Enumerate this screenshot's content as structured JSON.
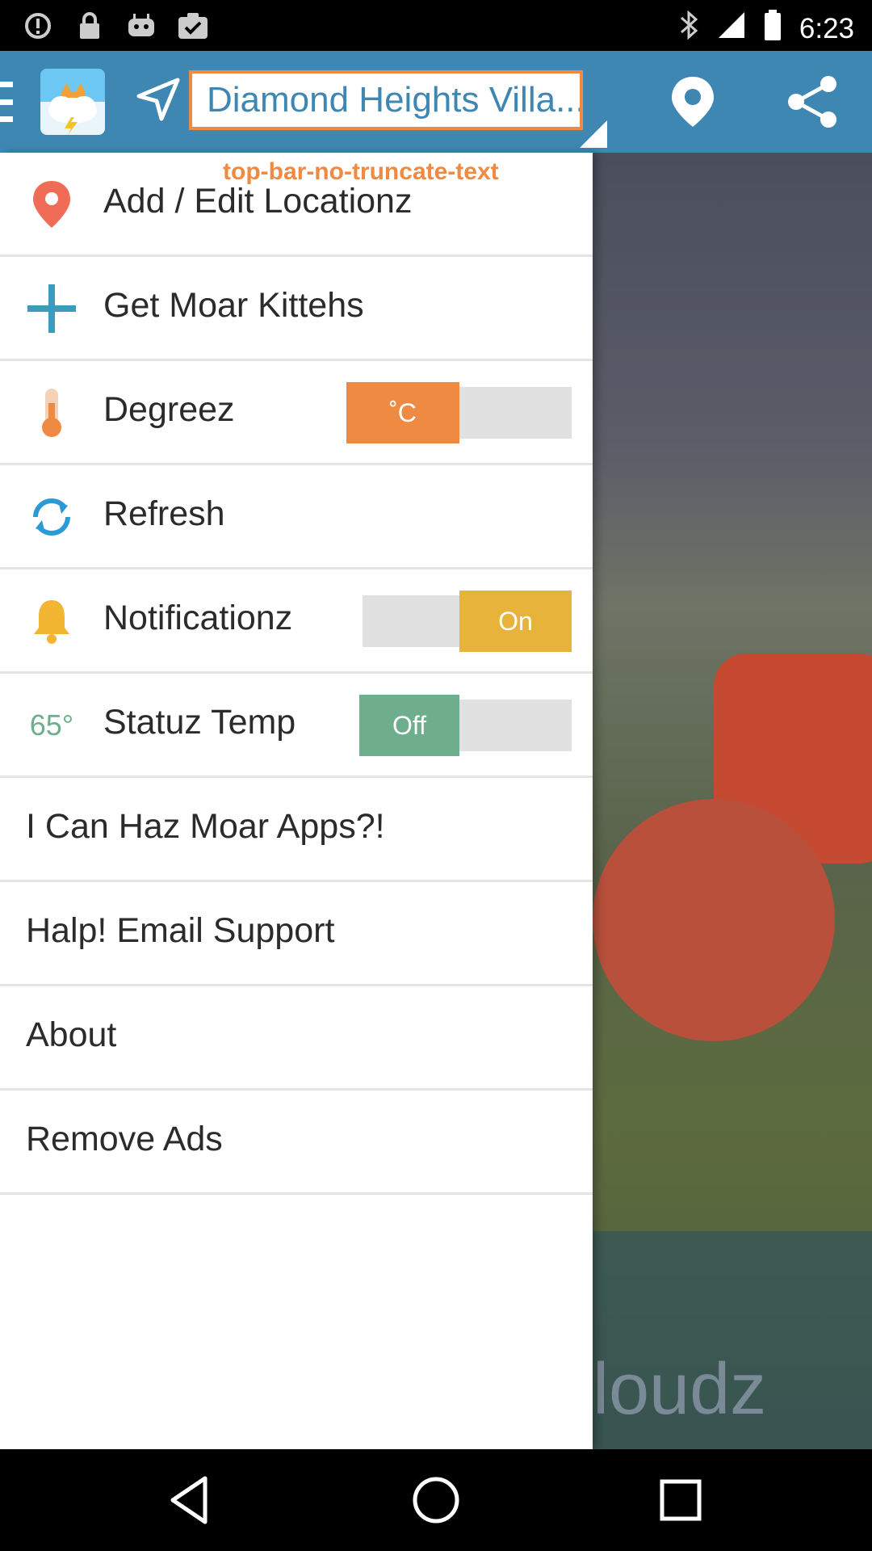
{
  "status_bar": {
    "time": "6:23",
    "left_icons": [
      "alert-icon",
      "lock-icon",
      "android-icon",
      "clipboard-check-icon"
    ],
    "right_icons": [
      "bluetooth-icon",
      "signal-icon",
      "battery-icon"
    ]
  },
  "app_bar": {
    "location_value": "Diamond Heights Villa...",
    "truncate_label": "top-bar-no-truncate-text",
    "accent_color": "#3f87b3"
  },
  "menu": {
    "items": [
      {
        "label": "Add / Edit Locationz",
        "icon": "map-pin-icon"
      },
      {
        "label": "Get Moar Kittehs",
        "icon": "plus-icon"
      },
      {
        "label": "Degreez",
        "icon": "thermometer-icon",
        "toggle_on": "˚C",
        "toggle_off": ""
      },
      {
        "label": "Refresh",
        "icon": "refresh-icon"
      },
      {
        "label": "Notificationz",
        "icon": "bell-icon",
        "toggle_on": "On",
        "toggle_off": ""
      },
      {
        "label": "Statuz Temp",
        "icon_text": "65°",
        "toggle_on": "Off",
        "toggle_off": ""
      },
      {
        "label": "I Can Haz Moar Apps?!"
      },
      {
        "label": "Halp! Email Support"
      },
      {
        "label": "About"
      },
      {
        "label": "Remove Ads"
      }
    ]
  },
  "background": {
    "partial_text": "loudz"
  },
  "colors": {
    "orange": "#ef8a43",
    "yellow": "#e8b33a",
    "green": "#6fae8d",
    "blue": "#3f87b3"
  },
  "nav_bar": {
    "buttons": [
      "back-icon",
      "home-icon",
      "recents-icon"
    ]
  }
}
